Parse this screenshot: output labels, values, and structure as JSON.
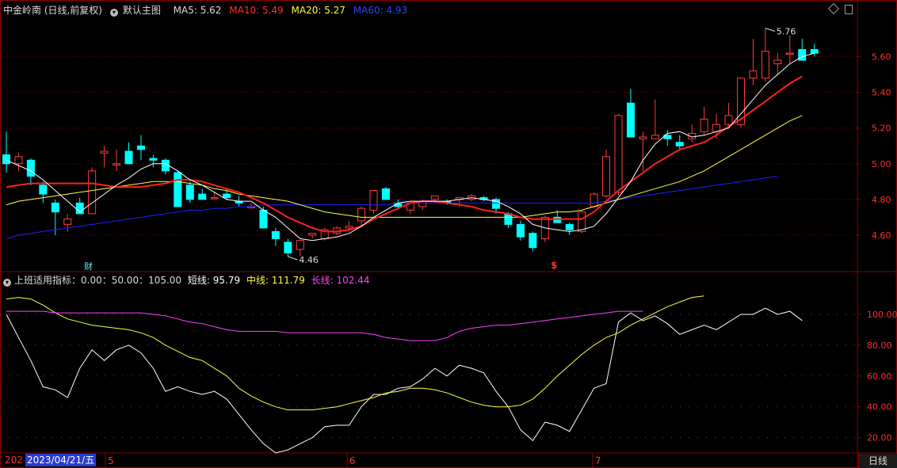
{
  "header": {
    "stock_title": "中金岭南 (日线,前复权)",
    "main_chart_label": "默认主图",
    "ma5": "MA5: 5.62",
    "ma10": "MA10: 5.49",
    "ma20": "MA20: 5.27",
    "ma60": "MA60: 4.93"
  },
  "indicator": {
    "name": "上班适用指标：0.00：50.00：105.00",
    "short": "短线: 95.79",
    "mid": "中线: 111.79",
    "long": "长线: 102.44"
  },
  "markers": {
    "high_label": "5.76",
    "low_label": "4.46",
    "finance_badge": "财",
    "s_badge": "$"
  },
  "bottom": {
    "year_stub": "202",
    "cursor_date": "2023/04/21/五",
    "period_tab": "日线"
  },
  "colors": {
    "up": "#ff3c3c",
    "down": "#00ffff",
    "ma5": "#ffffff",
    "ma10": "#ff2020",
    "ma20": "#ffff40",
    "ma60": "#2020ff",
    "short": "#ffffff",
    "mid": "#ffff40",
    "long": "#ff40ff",
    "grid": "#8b0000"
  },
  "chart_data": [
    {
      "type": "candlestick",
      "ylim": [
        4.4,
        5.82
      ],
      "price_ticks": [
        "5.60",
        "5.40",
        "5.20",
        "5.00",
        "4.80",
        "4.60"
      ],
      "month_labels": [
        "5",
        "6",
        "7"
      ],
      "ohlc": [
        [
          5.05,
          5.18,
          4.95,
          5.0
        ],
        [
          5.0,
          5.06,
          4.96,
          5.04
        ],
        [
          5.02,
          5.03,
          4.88,
          4.93
        ],
        [
          4.88,
          4.9,
          4.78,
          4.83
        ],
        [
          4.78,
          4.8,
          4.6,
          4.73
        ],
        [
          4.66,
          4.72,
          4.62,
          4.69
        ],
        [
          4.78,
          4.81,
          4.72,
          4.72
        ],
        [
          4.72,
          4.98,
          4.72,
          4.96
        ],
        [
          5.06,
          5.1,
          4.98,
          5.07
        ],
        [
          5.0,
          5.08,
          4.96,
          5.0
        ],
        [
          5.07,
          5.12,
          5.0,
          5.0
        ],
        [
          5.1,
          5.16,
          5.02,
          5.08
        ],
        [
          5.03,
          5.05,
          4.98,
          5.02
        ],
        [
          5.02,
          5.03,
          4.94,
          4.96
        ],
        [
          4.95,
          4.96,
          4.78,
          4.76
        ],
        [
          4.88,
          4.9,
          4.78,
          4.8
        ],
        [
          4.83,
          4.86,
          4.8,
          4.8
        ],
        [
          4.81,
          4.84,
          4.8,
          4.81
        ],
        [
          4.83,
          4.86,
          4.8,
          4.81
        ],
        [
          4.79,
          4.82,
          4.76,
          4.78
        ],
        [
          4.76,
          4.78,
          4.75,
          4.76
        ],
        [
          4.74,
          4.76,
          4.64,
          4.64
        ],
        [
          4.62,
          4.64,
          4.54,
          4.58
        ],
        [
          4.56,
          4.58,
          4.48,
          4.5
        ],
        [
          4.52,
          4.57,
          4.48,
          4.57
        ],
        [
          4.6,
          4.61,
          4.58,
          4.61
        ],
        [
          4.58,
          4.64,
          4.57,
          4.63
        ],
        [
          4.61,
          4.65,
          4.6,
          4.64
        ],
        [
          4.64,
          4.68,
          4.62,
          4.65
        ],
        [
          4.68,
          4.76,
          4.65,
          4.75
        ],
        [
          4.74,
          4.84,
          4.72,
          4.85
        ],
        [
          4.86,
          4.87,
          4.8,
          4.8
        ],
        [
          4.78,
          4.8,
          4.74,
          4.76
        ],
        [
          4.74,
          4.78,
          4.72,
          4.78
        ],
        [
          4.76,
          4.8,
          4.74,
          4.79
        ],
        [
          4.8,
          4.82,
          4.78,
          4.82
        ],
        [
          4.79,
          4.8,
          4.77,
          4.78
        ],
        [
          4.8,
          4.81,
          4.76,
          4.81
        ],
        [
          4.8,
          4.83,
          4.79,
          4.82
        ],
        [
          4.81,
          4.82,
          4.79,
          4.8
        ],
        [
          4.8,
          4.81,
          4.72,
          4.75
        ],
        [
          4.72,
          4.73,
          4.64,
          4.66
        ],
        [
          4.66,
          4.68,
          4.57,
          4.59
        ],
        [
          4.61,
          4.62,
          4.51,
          4.53
        ],
        [
          4.58,
          4.71,
          4.56,
          4.7
        ],
        [
          4.7,
          4.74,
          4.67,
          4.67
        ],
        [
          4.66,
          4.67,
          4.6,
          4.63
        ],
        [
          4.62,
          4.74,
          4.61,
          4.73
        ],
        [
          4.76,
          4.84,
          4.75,
          4.83
        ],
        [
          4.82,
          5.08,
          4.81,
          5.04
        ],
        [
          4.84,
          5.28,
          4.82,
          5.27
        ],
        [
          5.34,
          5.42,
          5.15,
          5.15
        ],
        [
          5.14,
          5.18,
          4.96,
          5.15
        ],
        [
          5.14,
          5.36,
          5.14,
          5.16
        ],
        [
          5.16,
          5.19,
          5.1,
          5.14
        ],
        [
          5.12,
          5.16,
          5.08,
          5.1
        ],
        [
          5.14,
          5.22,
          5.12,
          5.17
        ],
        [
          5.18,
          5.32,
          5.16,
          5.25
        ],
        [
          5.18,
          5.28,
          5.14,
          5.22
        ],
        [
          5.22,
          5.34,
          5.2,
          5.27
        ],
        [
          5.22,
          5.46,
          5.2,
          5.48
        ],
        [
          5.48,
          5.7,
          5.44,
          5.52
        ],
        [
          5.48,
          5.76,
          5.46,
          5.63
        ],
        [
          5.56,
          5.62,
          5.5,
          5.58
        ],
        [
          5.62,
          5.72,
          5.56,
          5.62
        ],
        [
          5.64,
          5.7,
          5.58,
          5.58
        ],
        [
          5.64,
          5.67,
          5.6,
          5.62
        ]
      ],
      "ma5": [
        5.02,
        4.99,
        4.96,
        4.91,
        4.85,
        4.79,
        4.73,
        4.78,
        4.83,
        4.88,
        4.92,
        4.97,
        5.0,
        5.0,
        4.96,
        4.91,
        4.88,
        4.84,
        4.8,
        4.79,
        4.79,
        4.74,
        4.7,
        4.64,
        4.58,
        4.57,
        4.58,
        4.59,
        4.61,
        4.65,
        4.7,
        4.74,
        4.78,
        4.79,
        4.79,
        4.79,
        4.79,
        4.8,
        4.81,
        4.8,
        4.79,
        4.76,
        4.72,
        4.66,
        4.64,
        4.63,
        4.62,
        4.63,
        4.65,
        4.72,
        4.81,
        4.9,
        5.02,
        5.11,
        5.17,
        5.18,
        5.15,
        5.16,
        5.18,
        5.2,
        5.28,
        5.36,
        5.44,
        5.5,
        5.56,
        5.6,
        5.62
      ],
      "ma10": [
        4.87,
        4.88,
        4.89,
        4.89,
        4.89,
        4.89,
        4.89,
        4.89,
        4.88,
        4.87,
        4.87,
        4.87,
        4.88,
        4.89,
        4.91,
        4.91,
        4.9,
        4.88,
        4.86,
        4.84,
        4.81,
        4.78,
        4.74,
        4.7,
        4.67,
        4.64,
        4.62,
        4.62,
        4.63,
        4.65,
        4.69,
        4.72,
        4.75,
        4.78,
        4.79,
        4.79,
        4.78,
        4.77,
        4.76,
        4.74,
        4.73,
        4.72,
        4.7,
        4.69,
        4.69,
        4.69,
        4.69,
        4.69,
        4.73,
        4.79,
        4.85,
        4.9,
        4.95,
        5.0,
        5.04,
        5.08,
        5.1,
        5.12,
        5.16,
        5.21,
        5.25,
        5.3,
        5.35,
        5.4,
        5.45,
        5.49
      ],
      "ma20": [
        4.77,
        4.79,
        4.8,
        4.81,
        4.82,
        4.83,
        4.84,
        4.85,
        4.86,
        4.87,
        4.88,
        4.89,
        4.9,
        4.9,
        4.9,
        4.89,
        4.88,
        4.86,
        4.85,
        4.83,
        4.82,
        4.81,
        4.8,
        4.79,
        4.77,
        4.75,
        4.73,
        4.72,
        4.71,
        4.7,
        4.7,
        4.7,
        4.7,
        4.7,
        4.7,
        4.7,
        4.7,
        4.7,
        4.7,
        4.7,
        4.7,
        4.7,
        4.7,
        4.71,
        4.72,
        4.73,
        4.73,
        4.74,
        4.76,
        4.78,
        4.8,
        4.82,
        4.84,
        4.86,
        4.88,
        4.9,
        4.93,
        4.96,
        5.0,
        5.04,
        5.08,
        5.12,
        5.16,
        5.2,
        5.24,
        5.27
      ],
      "ma60": [
        4.58,
        4.6,
        4.61,
        4.62,
        4.63,
        4.64,
        4.65,
        4.66,
        4.67,
        4.68,
        4.69,
        4.7,
        4.71,
        4.72,
        4.73,
        4.74,
        4.74,
        4.75,
        4.75,
        4.76,
        4.76,
        4.77,
        4.77,
        4.77,
        4.77,
        4.77,
        4.77,
        4.77,
        4.77,
        4.77,
        4.77,
        4.77,
        4.78,
        4.78,
        4.78,
        4.78,
        4.78,
        4.78,
        4.78,
        4.78,
        4.78,
        4.78,
        4.78,
        4.78,
        4.78,
        4.78,
        4.78,
        4.78,
        4.78,
        4.79,
        4.8,
        4.81,
        4.82,
        4.83,
        4.84,
        4.85,
        4.86,
        4.87,
        4.88,
        4.89,
        4.9,
        4.91,
        4.92,
        4.93
      ]
    },
    {
      "type": "line",
      "ylim": [
        10,
        118
      ],
      "y_ticks": [
        "100.00",
        "80.00",
        "60.00",
        "40.00",
        "20.00"
      ],
      "series": [
        {
          "name": "短线",
          "values": [
            100,
            85,
            70,
            53,
            51,
            46,
            65,
            77,
            70,
            77,
            80,
            75,
            65,
            50,
            53,
            50,
            48,
            50,
            45,
            35,
            25,
            16,
            10,
            12,
            16,
            20,
            27,
            28,
            28,
            40,
            48,
            48,
            52,
            53,
            58,
            65,
            60,
            67,
            65,
            62,
            50,
            40,
            25,
            18,
            30,
            28,
            24,
            38,
            52,
            55,
            95,
            101,
            96,
            99,
            94,
            87,
            90,
            93,
            90,
            95,
            100,
            100,
            104,
            100,
            102,
            96
          ]
        },
        {
          "name": "中线",
          "values": [
            110,
            111,
            110,
            106,
            101,
            97,
            95,
            93,
            92,
            91,
            90,
            88,
            85,
            80,
            76,
            72,
            70,
            65,
            60,
            52,
            47,
            43,
            40,
            38,
            38,
            38,
            39,
            40,
            42,
            44,
            46,
            49,
            50,
            52,
            52,
            51,
            49,
            46,
            43,
            41,
            40,
            40,
            41,
            45,
            52,
            60,
            67,
            74,
            80,
            85,
            88,
            93,
            97,
            101,
            105,
            108,
            111,
            112
          ]
        },
        {
          "name": "长线",
          "values": [
            102,
            102,
            102,
            102,
            101,
            101,
            101,
            101,
            101,
            101,
            101,
            101,
            100,
            99,
            97,
            95,
            94,
            92,
            90,
            89,
            89,
            89,
            89,
            88,
            88,
            88,
            88,
            88,
            88,
            88,
            87,
            85,
            84,
            83,
            83,
            83,
            85,
            89,
            91,
            92,
            93,
            93,
            94,
            95,
            96,
            97,
            98,
            99,
            100,
            101,
            102,
            102,
            102
          ]
        }
      ]
    }
  ]
}
